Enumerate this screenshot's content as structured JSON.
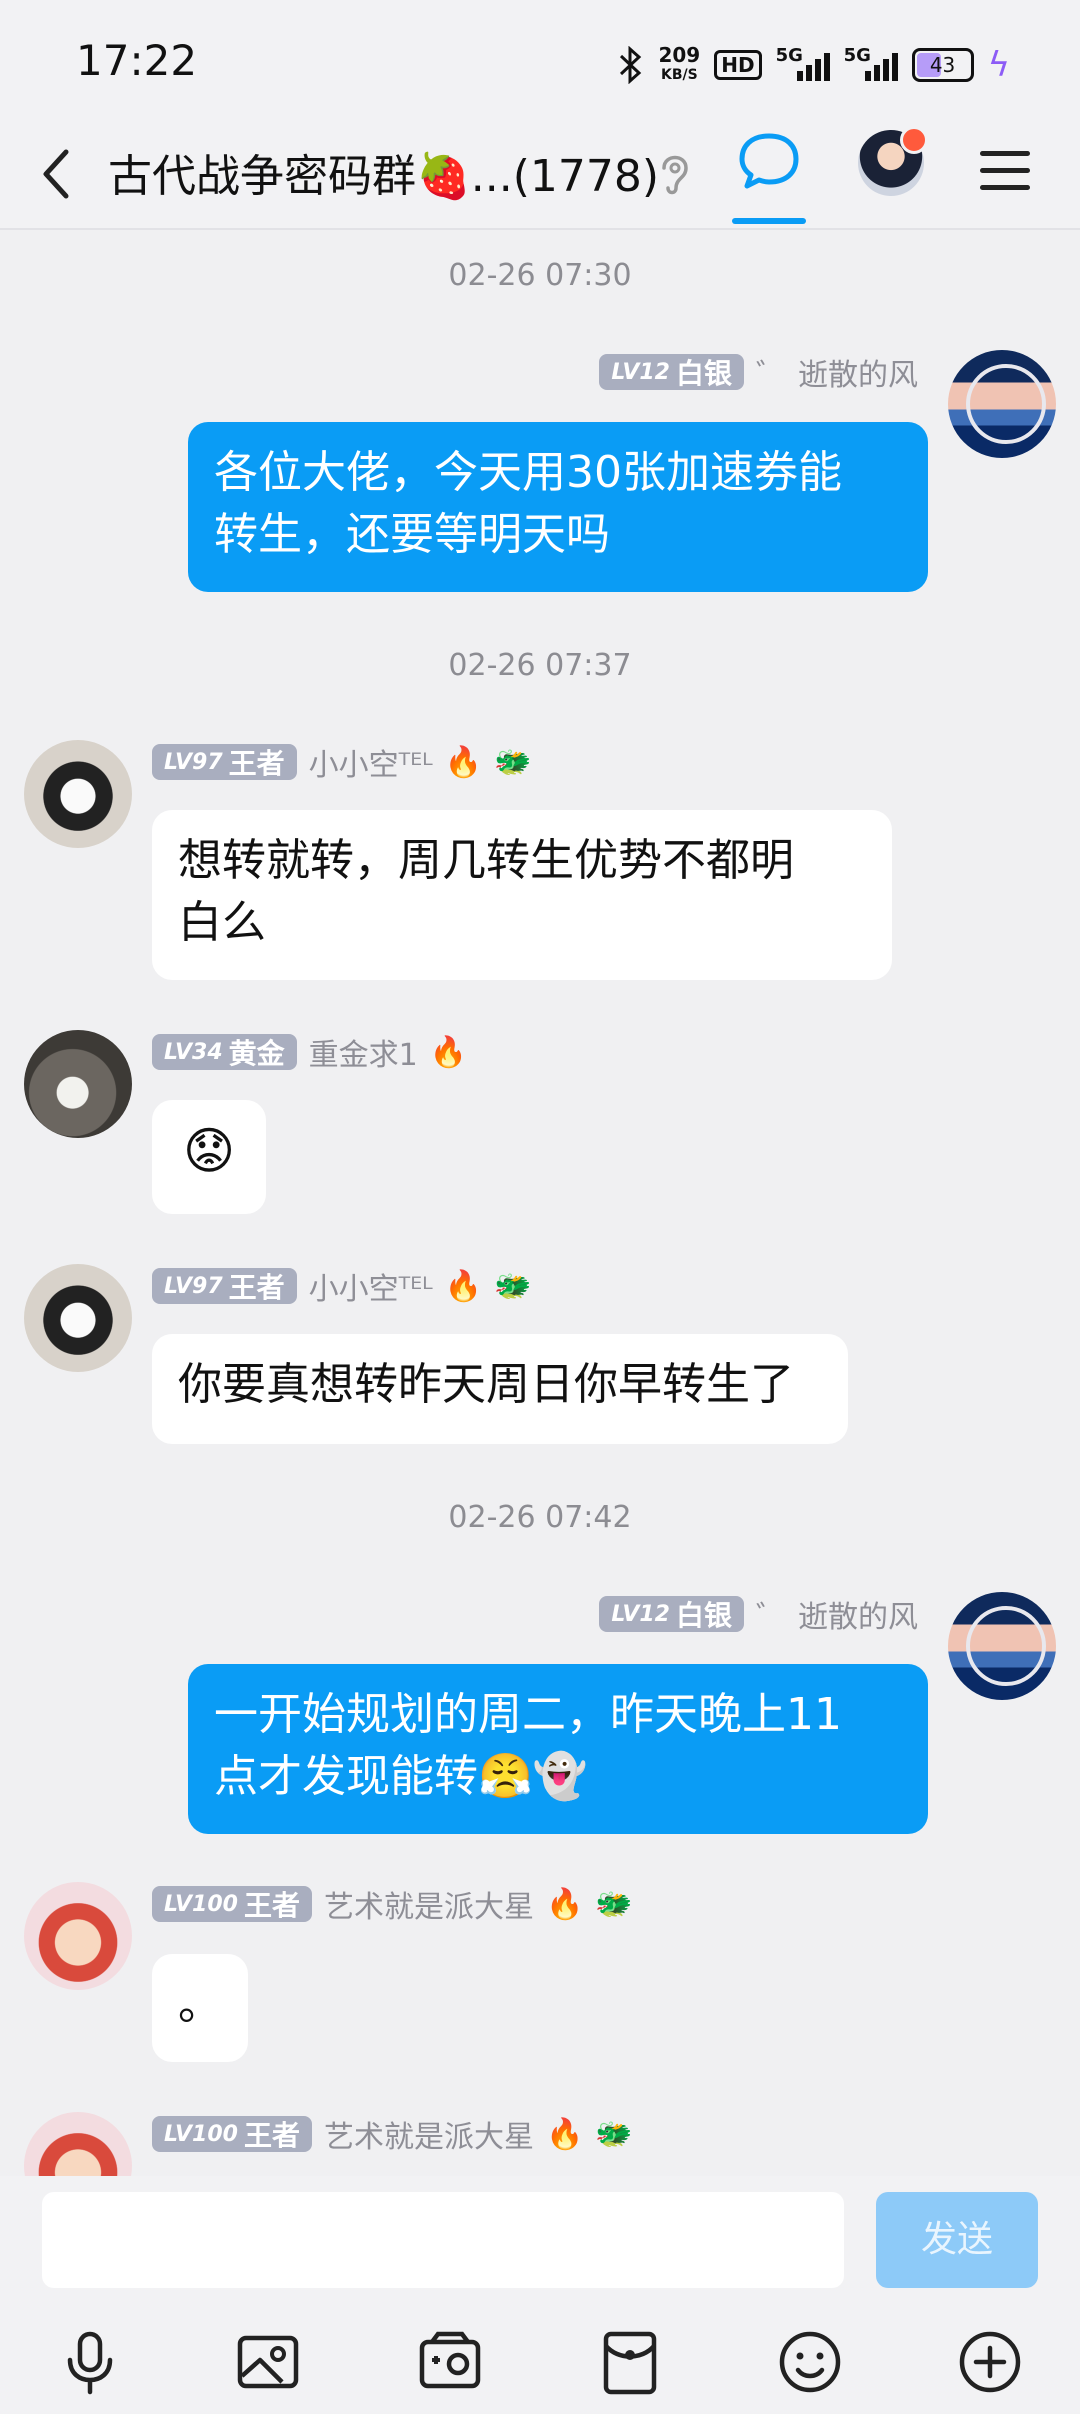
{
  "status_bar": {
    "time": "17:22",
    "net_speed_value": "209",
    "net_speed_unit": "KB/S",
    "hd_label": "HD",
    "signal1_label": "5G",
    "signal2_label": "5G",
    "battery": "43"
  },
  "header": {
    "title": "古代战争密码群🍓...(1778)"
  },
  "messages": [
    {
      "time": "02-26 07:30"
    },
    {
      "side": "me",
      "level": "LV12",
      "rank": "白银",
      "name_suffix": "゛",
      "name": "逝散的风",
      "text_line1": "各位大佬，今天用30张加速券能",
      "text_line2": "转生，还要等明天吗"
    },
    {
      "time": "02-26 07:37"
    },
    {
      "side": "other",
      "level": "LV97",
      "rank": "王者",
      "name": "小小空ᵀᴱᴸ",
      "emoji": "🔥",
      "emoji2": "🐲",
      "text_line1": "想转就转，周几转生优势不都明",
      "text_line2": "白么"
    },
    {
      "side": "other",
      "level": "LV34",
      "rank": "黄金",
      "name": "重金求1",
      "emoji": "🔥",
      "text": "😟"
    },
    {
      "side": "other",
      "level": "LV97",
      "rank": "王者",
      "name": "小小空ᵀᴱᴸ",
      "emoji": "🔥",
      "emoji2": "🐲",
      "text": "你要真想转昨天周日你早转生了"
    },
    {
      "time": "02-26 07:42"
    },
    {
      "side": "me",
      "level": "LV12",
      "rank": "白银",
      "name_suffix": "゛",
      "name": "逝散的风",
      "text_line1": "一开始规划的周二，昨天晚上11",
      "text_line2": "点才发现能转😤👻"
    },
    {
      "side": "other",
      "level": "LV100",
      "rank": "王者",
      "name": "艺术就是派大星",
      "emoji": "🔥",
      "emoji2": "🐲",
      "text": "。"
    },
    {
      "side": "other",
      "level": "LV100",
      "rank": "王者",
      "name": "艺术就是派大星",
      "emoji": "🔥",
      "emoji2": "🐲"
    }
  ],
  "input": {
    "placeholder": "",
    "send_label": "发送"
  },
  "toolbar": [
    "microphone-icon",
    "image-icon",
    "camera-icon",
    "red-packet-icon",
    "emoji-icon",
    "plus-icon"
  ],
  "colors": {
    "accent": "#0a9cf5",
    "send_disabled": "#8dcaf8",
    "background": "#f0f0f2",
    "badge": "#a9aebf"
  }
}
